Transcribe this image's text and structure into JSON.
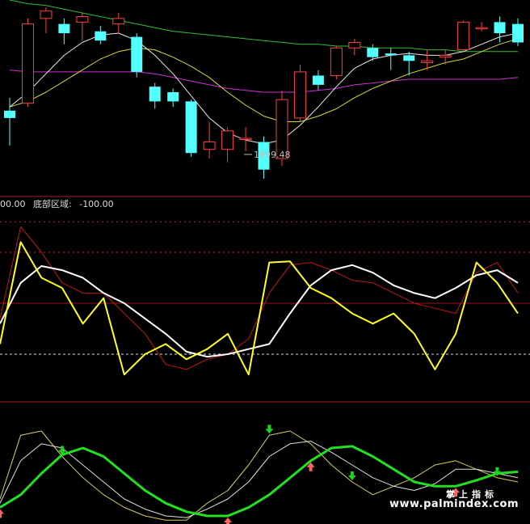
{
  "header": {
    "value_left": "00.00",
    "label": "底部区域:",
    "value": "-100.00"
  },
  "watermark": {
    "cn": "掌上指标",
    "url": "www.palmindex.com"
  },
  "colors": {
    "background": "#000000",
    "divider": "#a0202c",
    "up_candle": "#ff4040",
    "down_candle": "#54ffff",
    "ma_white": "#e8e8e8",
    "ma_yellow": "#d8d830",
    "ma_magenta": "#d030d0",
    "ma_green": "#30c030",
    "kdj_yellow": "#ffff20",
    "kdj_white": "#ffffff",
    "kdj_red": "#c01818",
    "wave_green": "#20e020",
    "arrow_up": "#ff6060",
    "arrow_down": "#20d020"
  },
  "chart_data": [
    {
      "type": "candlestick",
      "annotations": [
        {
          "text": "1999.48",
          "candle_index": 13
        }
      ],
      "candles": [
        {
          "o": 0.7,
          "h": 0.77,
          "l": 0.51,
          "c": 0.66
        },
        {
          "o": 0.74,
          "h": 1.2,
          "l": 0.72,
          "c": 1.17
        },
        {
          "o": 1.2,
          "h": 1.26,
          "l": 1.12,
          "c": 1.24
        },
        {
          "o": 1.17,
          "h": 1.2,
          "l": 1.06,
          "c": 1.12
        },
        {
          "o": 1.18,
          "h": 1.23,
          "l": 1.08,
          "c": 1.21
        },
        {
          "o": 1.13,
          "h": 1.16,
          "l": 1.06,
          "c": 1.08
        },
        {
          "o": 1.17,
          "h": 1.23,
          "l": 1.12,
          "c": 1.2
        },
        {
          "o": 1.1,
          "h": 1.12,
          "l": 0.88,
          "c": 0.91
        },
        {
          "o": 0.83,
          "h": 0.85,
          "l": 0.71,
          "c": 0.75
        },
        {
          "o": 0.8,
          "h": 0.82,
          "l": 0.72,
          "c": 0.75
        },
        {
          "o": 0.75,
          "h": 0.76,
          "l": 0.45,
          "c": 0.47
        },
        {
          "o": 0.49,
          "h": 0.64,
          "l": 0.44,
          "c": 0.53
        },
        {
          "o": 0.49,
          "h": 0.61,
          "l": 0.42,
          "c": 0.59
        },
        {
          "o": 0.55,
          "h": 0.61,
          "l": 0.48,
          "c": 0.55
        },
        {
          "o": 0.53,
          "h": 0.56,
          "l": 0.33,
          "c": 0.38
        },
        {
          "o": 0.44,
          "h": 0.81,
          "l": 0.4,
          "c": 0.76
        },
        {
          "o": 0.66,
          "h": 0.95,
          "l": 0.64,
          "c": 0.91
        },
        {
          "o": 0.89,
          "h": 0.92,
          "l": 0.81,
          "c": 0.84
        },
        {
          "o": 0.89,
          "h": 1.05,
          "l": 0.87,
          "c": 1.04
        },
        {
          "o": 1.04,
          "h": 1.09,
          "l": 1.0,
          "c": 1.07
        },
        {
          "o": 1.04,
          "h": 1.06,
          "l": 0.97,
          "c": 0.99
        },
        {
          "o": 1.01,
          "h": 1.04,
          "l": 0.92,
          "c": 1.0
        },
        {
          "o": 1.0,
          "h": 1.02,
          "l": 0.89,
          "c": 0.97
        },
        {
          "o": 0.96,
          "h": 1.03,
          "l": 0.92,
          "c": 0.97
        },
        {
          "o": 0.99,
          "h": 1.03,
          "l": 0.95,
          "c": 1.0
        },
        {
          "o": 1.03,
          "h": 1.19,
          "l": 1.02,
          "c": 1.18
        },
        {
          "o": 1.15,
          "h": 1.18,
          "l": 1.13,
          "c": 1.15
        },
        {
          "o": 1.18,
          "h": 1.21,
          "l": 1.07,
          "c": 1.12
        },
        {
          "o": 1.17,
          "h": 1.2,
          "l": 1.05,
          "c": 1.07
        }
      ],
      "ma_white": [
        0.72,
        0.8,
        0.9,
        1.0,
        1.07,
        1.11,
        1.12,
        1.08,
        1.0,
        0.9,
        0.78,
        0.66,
        0.58,
        0.54,
        0.52,
        0.54,
        0.62,
        0.72,
        0.83,
        0.93,
        0.98,
        1.0,
        1.01,
        1.0,
        1.0,
        1.02,
        1.06,
        1.1,
        1.12
      ],
      "ma_yellow": [
        0.72,
        0.75,
        0.8,
        0.86,
        0.92,
        0.98,
        1.02,
        1.04,
        1.03,
        0.99,
        0.94,
        0.88,
        0.8,
        0.73,
        0.67,
        0.64,
        0.64,
        0.67,
        0.71,
        0.77,
        0.82,
        0.86,
        0.9,
        0.93,
        0.96,
        0.98,
        1.02,
        1.06,
        1.09
      ],
      "ma_magenta": [
        0.92,
        0.91,
        0.91,
        0.91,
        0.91,
        0.91,
        0.91,
        0.91,
        0.9,
        0.88,
        0.86,
        0.84,
        0.82,
        0.81,
        0.8,
        0.8,
        0.8,
        0.81,
        0.82,
        0.84,
        0.85,
        0.86,
        0.87,
        0.87,
        0.87,
        0.87,
        0.87,
        0.87,
        0.88
      ],
      "ma_green": [
        1.3,
        1.28,
        1.27,
        1.25,
        1.23,
        1.21,
        1.19,
        1.17,
        1.15,
        1.13,
        1.12,
        1.11,
        1.1,
        1.09,
        1.08,
        1.07,
        1.06,
        1.06,
        1.05,
        1.05,
        1.04,
        1.04,
        1.04,
        1.03,
        1.03,
        1.02,
        1.02,
        1.02,
        1.02
      ]
    },
    {
      "type": "line",
      "subtype": "oscillator",
      "label": "底部区域",
      "threshold_line": -100.0,
      "yellow": [
        -80,
        120,
        50,
        30,
        -40,
        10,
        -140,
        -100,
        -80,
        -110,
        -90,
        -60,
        -140,
        80,
        82,
        30,
        10,
        -20,
        -40,
        -20,
        -60,
        -130,
        -60,
        80,
        40,
        -20
      ],
      "white": [
        -40,
        40,
        73,
        65,
        50,
        20,
        0,
        -30,
        -60,
        -95,
        -105,
        -100,
        -90,
        -80,
        -20,
        35,
        65,
        75,
        60,
        35,
        20,
        10,
        30,
        55,
        65,
        40
      ],
      "red": [
        -30,
        150,
        100,
        40,
        20,
        20,
        -20,
        -60,
        -120,
        -130,
        -110,
        -100,
        -70,
        20,
        75,
        80,
        65,
        45,
        40,
        20,
        0,
        -10,
        -20,
        60,
        80,
        20
      ]
    },
    {
      "type": "line",
      "subtype": "wave",
      "green": [
        10,
        25,
        50,
        72,
        80,
        70,
        50,
        30,
        15,
        5,
        0,
        0,
        10,
        25,
        45,
        65,
        80,
        82,
        70,
        55,
        40,
        35,
        35,
        42,
        50,
        52
      ],
      "white": [
        15,
        65,
        85,
        80,
        60,
        40,
        20,
        8,
        0,
        -2,
        8,
        20,
        40,
        70,
        85,
        88,
        75,
        60,
        45,
        35,
        30,
        38,
        55,
        55,
        50,
        45
      ],
      "yellow": [
        20,
        95,
        100,
        70,
        45,
        25,
        10,
        0,
        -5,
        -5,
        15,
        30,
        60,
        95,
        100,
        85,
        60,
        40,
        25,
        35,
        45,
        60,
        65,
        55,
        45,
        40
      ],
      "arrows_up_index": [
        0,
        11,
        15,
        22
      ],
      "arrows_down_index": [
        3,
        13,
        17,
        24
      ]
    }
  ]
}
